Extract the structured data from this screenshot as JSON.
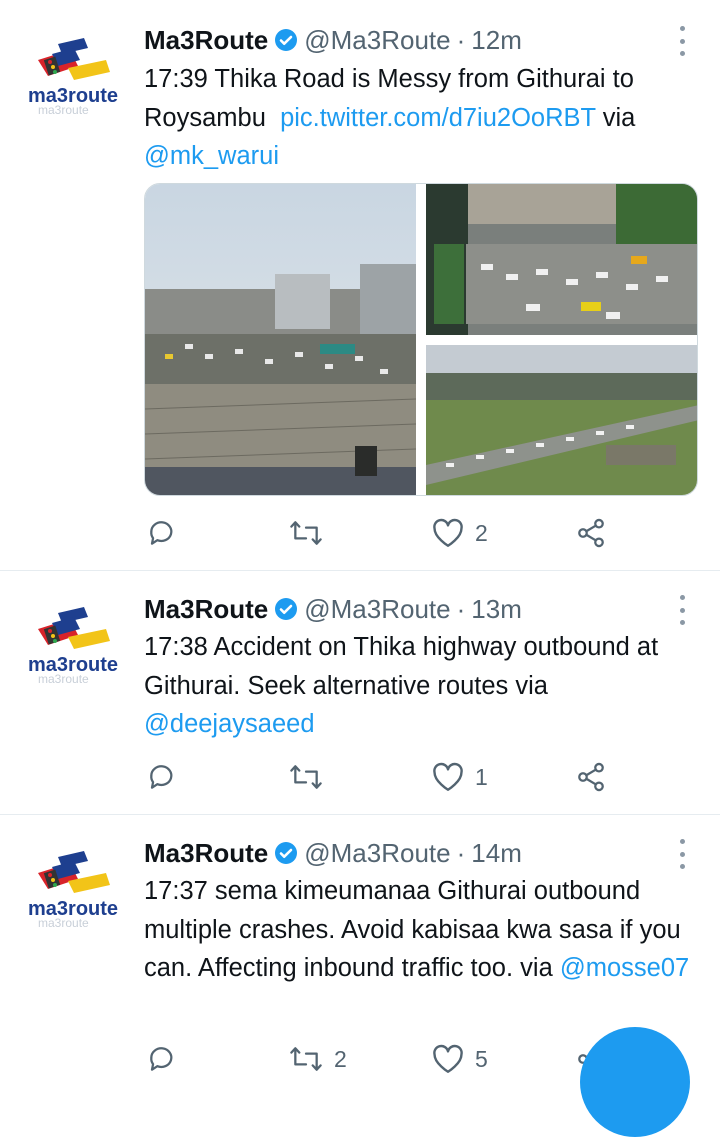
{
  "tweets": [
    {
      "name": "Ma3Route",
      "handle": "@Ma3Route",
      "separator": "·",
      "time": "12m",
      "avatar_text": "ma3route",
      "text_plain": "17:39 Thika Road is Messy from Githurai to Roysambu  ",
      "link": "pic.twitter.com/d7iu2OoRBT",
      "text_after": " via ",
      "mention": "@mk_warui",
      "reply_count": "",
      "retweet_count": "",
      "like_count": "2"
    },
    {
      "name": "Ma3Route",
      "handle": "@Ma3Route",
      "separator": "·",
      "time": "13m",
      "avatar_text": "ma3route",
      "text_plain": "17:38 Accident on Thika highway outbound at Githurai. Seek alternative routes via ",
      "mention": "@deejaysaeed",
      "reply_count": "",
      "retweet_count": "",
      "like_count": "1"
    },
    {
      "name": "Ma3Route",
      "handle": "@Ma3Route",
      "separator": "·",
      "time": "14m",
      "avatar_text": "ma3route",
      "text_plain": "17:37 sema kimeumanaa Githurai outbound multiple crashes. Avoid kabisaa kwa sasa if you can. Affecting inbound traffic too. via ",
      "mention": "@mosse07",
      "reply_count": "",
      "retweet_count": "2",
      "like_count": "5"
    }
  ],
  "icons": {
    "reply": "reply-icon",
    "retweet": "retweet-icon",
    "like": "heart-icon",
    "share": "share-icon",
    "more": "more-vertical-icon",
    "verified": "verified-badge-icon",
    "compose": "compose-fab"
  },
  "colors": {
    "link": "#1d9bf0",
    "secondary": "#536471",
    "divider": "#e6ecf0",
    "verified": "#1d9bf0"
  }
}
